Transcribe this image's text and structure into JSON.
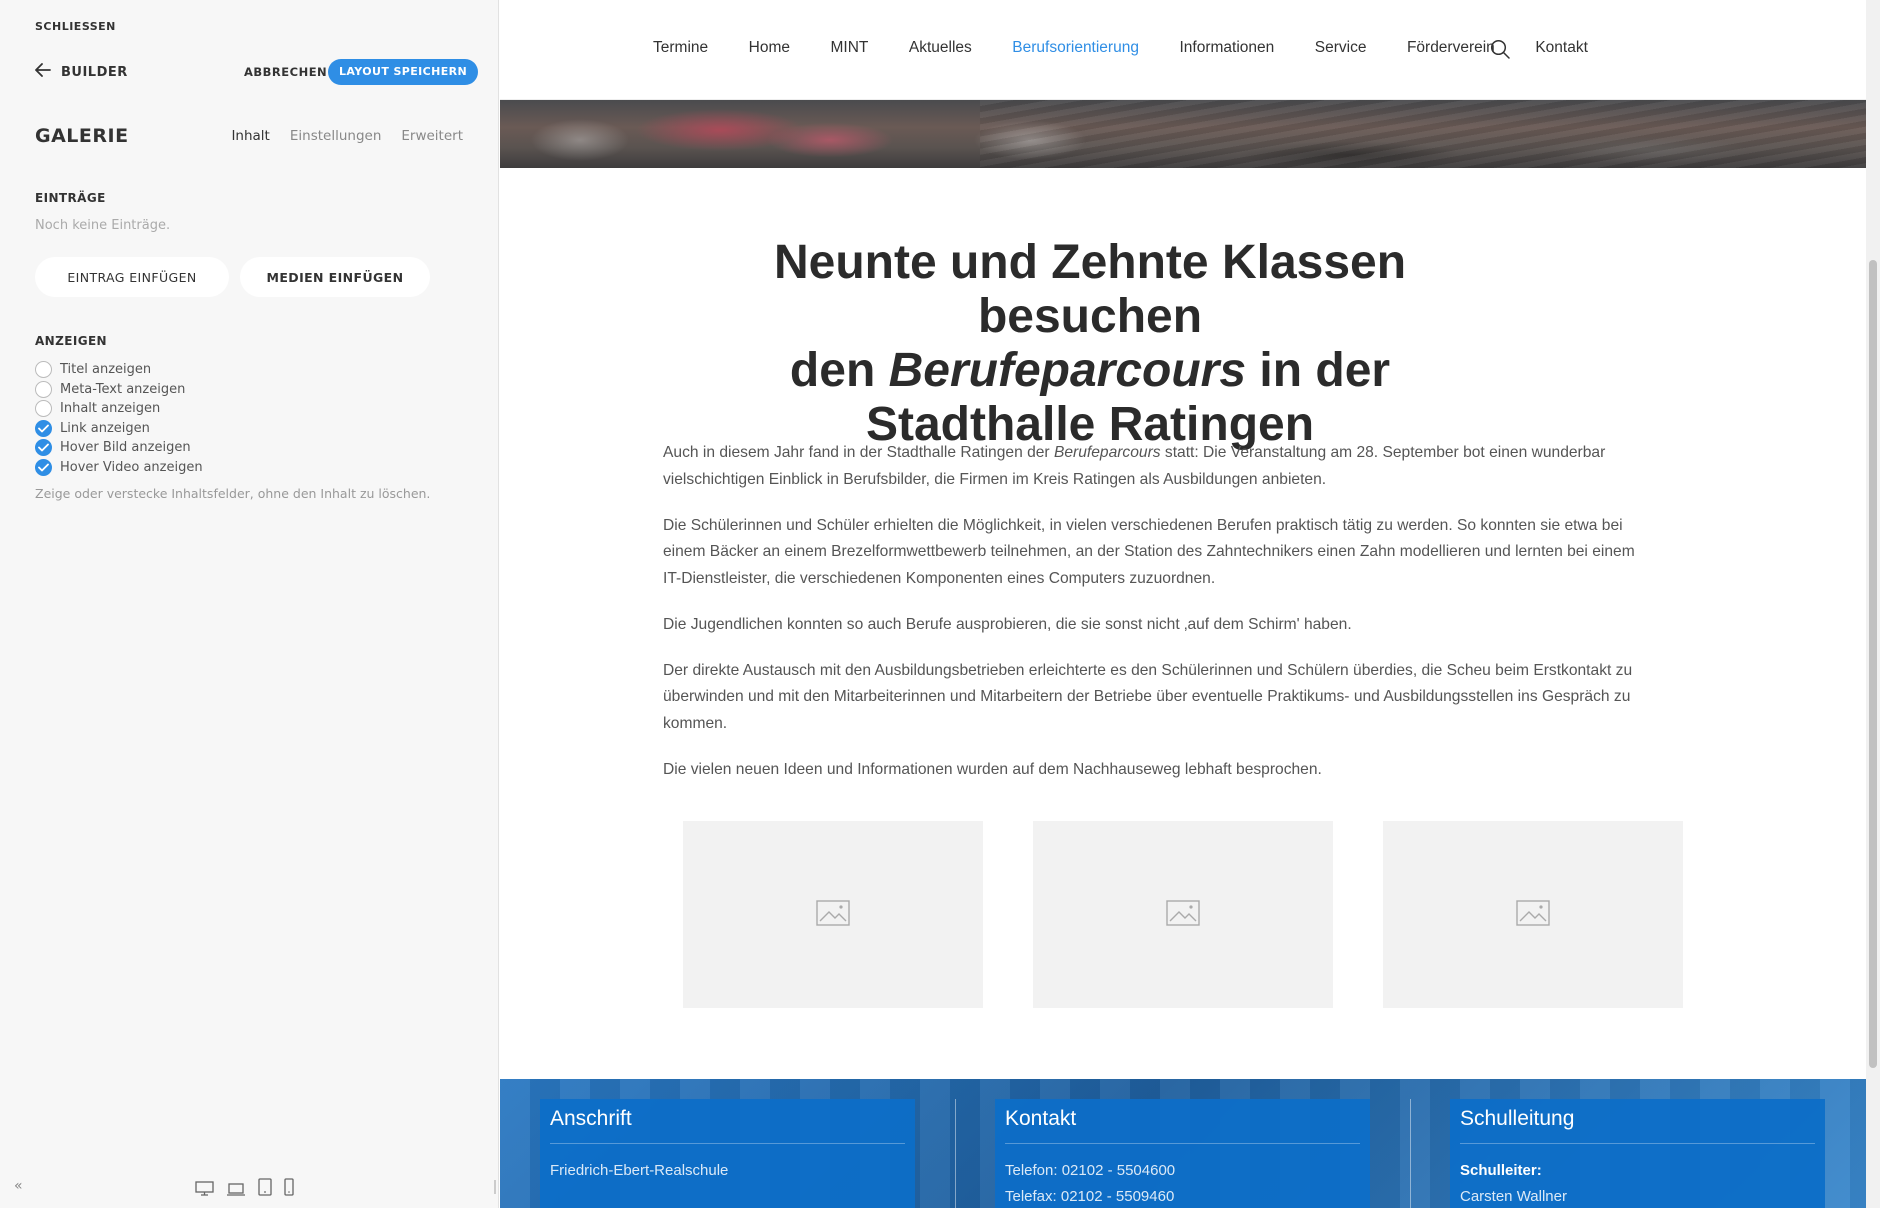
{
  "panel": {
    "close_label": "SCHLIESSEN",
    "back_label": "BUILDER",
    "cancel_label": "ABBRECHEN",
    "save_label": "LAYOUT SPEICHERN",
    "title": "GALERIE",
    "tabs": [
      {
        "label": "Inhalt",
        "active": true
      },
      {
        "label": "Einstellungen",
        "active": false
      },
      {
        "label": "Erweitert",
        "active": false
      }
    ],
    "entries_label": "EINTRÄGE",
    "entries_empty": "Noch keine Einträge.",
    "insert_entry_label": "EINTRAG EINFÜGEN",
    "insert_media_label": "MEDIEN EINFÜGEN",
    "display_label": "ANZEIGEN",
    "options": [
      {
        "label": "Titel anzeigen",
        "checked": false
      },
      {
        "label": "Meta-Text anzeigen",
        "checked": false
      },
      {
        "label": "Inhalt anzeigen",
        "checked": false
      },
      {
        "label": "Link anzeigen",
        "checked": true
      },
      {
        "label": "Hover Bild anzeigen",
        "checked": true
      },
      {
        "label": "Hover Video anzeigen",
        "checked": true
      }
    ],
    "hint": "Zeige oder verstecke Inhaltsfelder, ohne den Inhalt zu löschen.",
    "collapse_glyph": "«",
    "device_icons": [
      "desktop-icon",
      "laptop-icon",
      "tablet-icon",
      "phone-icon"
    ]
  },
  "nav": {
    "items": [
      {
        "label": "Termine",
        "active": false
      },
      {
        "label": "Home",
        "active": false
      },
      {
        "label": "MINT",
        "active": false
      },
      {
        "label": "Aktuelles",
        "active": false
      },
      {
        "label": "Berufsorientierung",
        "active": true
      },
      {
        "label": "Informationen",
        "active": false
      },
      {
        "label": "Service",
        "active": false
      },
      {
        "label": "Förderverein",
        "active": false
      },
      {
        "label": "Kontakt",
        "active": false
      }
    ],
    "search_icon": "search-icon"
  },
  "article": {
    "title_line1": "Neunte und Zehnte Klassen besuchen",
    "title_pre": "den ",
    "title_em": "Berufeparcours",
    "title_post": " in der Stadthalle Ratingen",
    "p1_pre": "Auch in diesem Jahr fand in der Stadthalle Ratingen der ",
    "p1_em": "Berufeparcours",
    "p1_post": " statt: Die Veranstaltung am 28. September bot einen wunderbar vielschichtigen Einblick in Berufsbilder, die Firmen im Kreis Ratingen als Ausbildungen anbieten.",
    "p2": "Die Schülerinnen und Schüler erhielten die Möglichkeit, in vielen verschiedenen Berufen praktisch tätig zu werden. So konnten sie etwa bei einem Bäcker an einem Brezelformwettbewerb teilnehmen, an der Station des Zahntechnikers einen Zahn modellieren und lernten bei einem IT-Dienstleister, die verschiedenen Komponenten eines Computers zuzuordnen.",
    "p3": "Die Jugendlichen konnten so auch Berufe ausprobieren, die sie sonst nicht ‚auf dem Schirm' haben.",
    "p4": "Der direkte Austausch mit den Ausbildungsbetrieben erleichterte es den Schülerinnen und Schülern überdies, die Scheu beim Erstkontakt zu überwinden und mit den Mitarbeiterinnen und Mitarbeitern der Betriebe über eventuelle Praktikums- und Ausbildungsstellen ins Gespräch zu kommen.",
    "p5": "Die vielen neuen Ideen und Informationen wurden auf dem Nachhauseweg lebhaft besprochen."
  },
  "gallery": {
    "placeholder_icon": "image-placeholder-icon",
    "count": 3
  },
  "footer": {
    "address": {
      "title": "Anschrift",
      "line1": "Friedrich-Ebert-Realschule"
    },
    "contact": {
      "title": "Kontakt",
      "phone": "Telefon: 02102 - 5504600",
      "fax": "Telefax: 02102 - 5509460"
    },
    "management": {
      "title": "Schulleitung",
      "role": "Schulleiter:",
      "name": "Carsten Wallner"
    }
  },
  "colors": {
    "accent": "#2f8ee5",
    "footer_blue": "#0c6ec8",
    "panel_bg": "#f7f7f7"
  }
}
